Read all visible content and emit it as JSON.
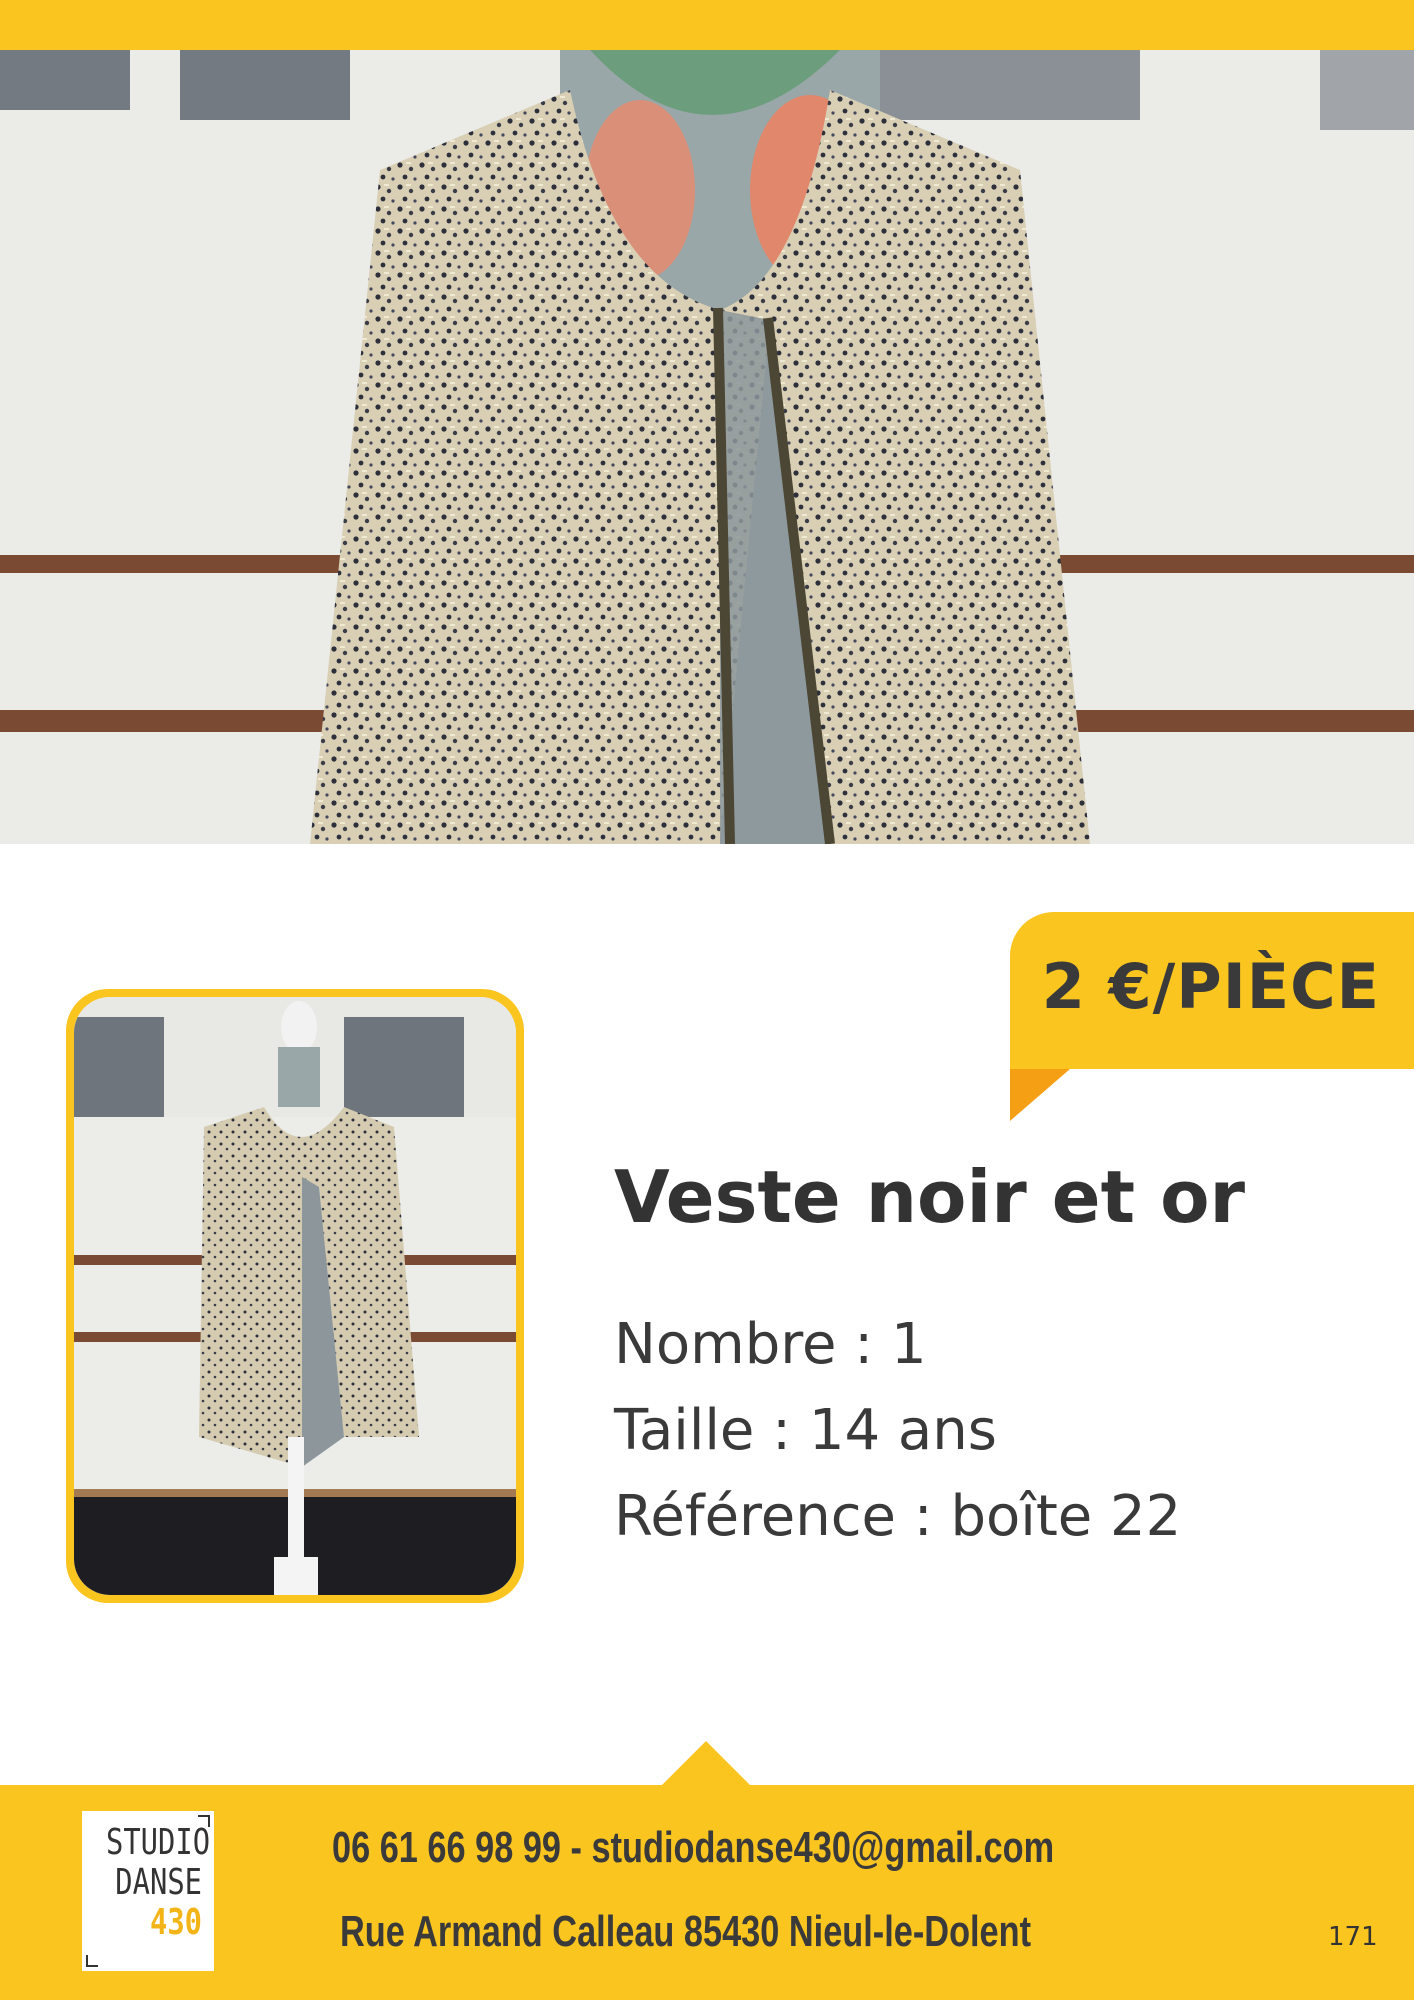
{
  "price": {
    "label": "2 €/PIÈCE"
  },
  "product": {
    "title": "Veste noir et or",
    "details": [
      "Nombre : 1",
      "Taille : 14 ans",
      "Référence : boîte 22"
    ]
  },
  "footer": {
    "logo": {
      "line1": "STUDIO",
      "line2": "DANSE",
      "line3": "430"
    },
    "contact_line": "06 61 66 98 99 - studiodanse430@gmail.com",
    "address": "Rue Armand Calleau 85430 Nieul-le-Dolent",
    "page_number": "171"
  },
  "colors": {
    "accent": "#fbc520",
    "accent_dark": "#f59f14",
    "text": "#3a3a3a"
  },
  "images": {
    "hero": "jacket-on-mannequin-closeup",
    "thumbnail": "jacket-on-mannequin-full"
  }
}
